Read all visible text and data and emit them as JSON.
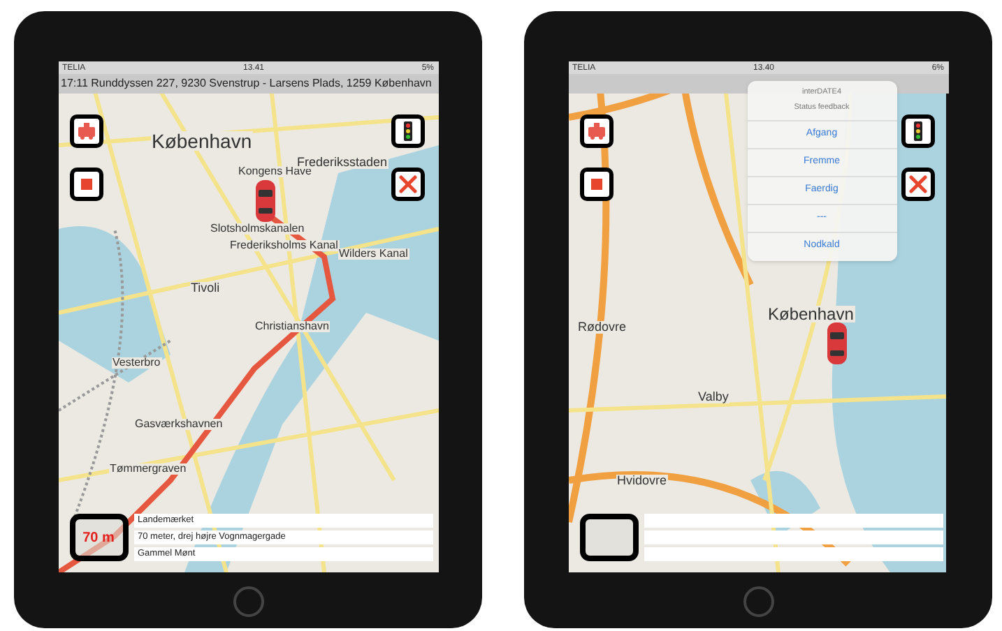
{
  "devices": [
    {
      "status_bar": {
        "carrier": "TELIA",
        "time": "13.41",
        "battery": "5%"
      },
      "address_bar": "17:11 Runddyssen 227, 9230 Svenstrup - Larsens Plads, 1259 København",
      "map": {
        "kind": "city",
        "route": true,
        "labels": [
          "København",
          "Kongens Have",
          "Frederiksstaden",
          "Slotsholmskanalen",
          "Frederiksholms Kanal",
          "Tivoli",
          "Christianshavn",
          "Vesterbro",
          "Gasværkshavnen",
          "Tømmergraven",
          "Wilders Kanal"
        ]
      },
      "distance": "70 m",
      "info_rows": [
        "Landemærket",
        "70 meter, drej højre Vognmagergade",
        "Gammel Mønt"
      ]
    },
    {
      "status_bar": {
        "carrier": "TELIA",
        "time": "13.40",
        "battery": "6%"
      },
      "map": {
        "kind": "region",
        "labels": [
          "København",
          "Rødovre",
          "Valby",
          "Hvidovre"
        ]
      },
      "popover": {
        "title": "interDATE4",
        "subtitle": "Status feedback",
        "items": [
          "Afgang",
          "Fremme",
          "Faerdig",
          "---",
          "Nodkald"
        ]
      }
    }
  ]
}
